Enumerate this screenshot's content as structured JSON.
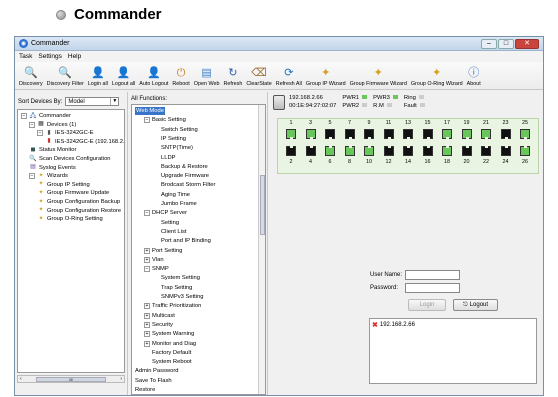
{
  "heading": "Commander",
  "window": {
    "title": "Commander"
  },
  "menu": [
    "Task",
    "Settings",
    "Help"
  ],
  "toolbar": [
    {
      "label": "Discovery",
      "icon": "magnifier-icon"
    },
    {
      "label": "Discovery Filter",
      "icon": "filter-magnifier-icon"
    },
    {
      "label": "Login all",
      "icon": "user-icon"
    },
    {
      "label": "Logout all",
      "icon": "user-gray-icon"
    },
    {
      "label": "Auto Logout",
      "icon": "user-green-icon"
    },
    {
      "label": "Reboot",
      "icon": "reboot-icon"
    },
    {
      "label": "Open Web",
      "icon": "web-page-icon"
    },
    {
      "label": "Refresh",
      "icon": "refresh-icon"
    },
    {
      "label": "ClearState",
      "icon": "clear-state-icon"
    },
    {
      "label": "Refresh All",
      "icon": "refresh-all-icon"
    },
    {
      "label": "Group IP Wizard",
      "icon": "wand-icon"
    },
    {
      "label": "Group Firmware Wizard",
      "icon": "wand-icon"
    },
    {
      "label": "Group O-Ring Wizard",
      "icon": "wand-icon"
    },
    {
      "label": "About",
      "icon": "info-icon"
    }
  ],
  "sort": {
    "label": "Sort Devices By:",
    "value": "Model"
  },
  "tree": [
    {
      "label": "Commander",
      "indent": 0
    },
    {
      "label": "Devices (1)",
      "indent": 1
    },
    {
      "label": "IES-3242GC-E",
      "indent": 2
    },
    {
      "label": "IES-3242GC-E (192.168.2.66,",
      "indent": 3
    },
    {
      "label": "Status Monitor",
      "indent": 1
    },
    {
      "label": "Scan Devices Configuration",
      "indent": 1
    },
    {
      "label": "Syslog Events",
      "indent": 1
    },
    {
      "label": "Wizards",
      "indent": 1
    },
    {
      "label": "Group IP Setting",
      "indent": 2
    },
    {
      "label": "Group Firmware Update",
      "indent": 2
    },
    {
      "label": "Group Configuration Backup",
      "indent": 2
    },
    {
      "label": "Group Configuration Restore",
      "indent": 2
    },
    {
      "label": "Group O-Ring Setting",
      "indent": 2
    }
  ],
  "scroll_arrows": {
    "left": "‹",
    "mid": "III",
    "right": "›"
  },
  "functions": {
    "header": "All Functions:",
    "items": [
      {
        "label": "Web Mode",
        "indent": 0,
        "selected": true
      },
      {
        "label": "Basic Setting",
        "indent": 1,
        "box": "−"
      },
      {
        "label": "Switch Setting",
        "indent": 2
      },
      {
        "label": "IP Setting",
        "indent": 2
      },
      {
        "label": "SNTP(Time)",
        "indent": 2
      },
      {
        "label": "LLDP",
        "indent": 2
      },
      {
        "label": "Backup & Restore",
        "indent": 2
      },
      {
        "label": "Upgrade Firmware",
        "indent": 2
      },
      {
        "label": "Brodcast Storm Filter",
        "indent": 2
      },
      {
        "label": "Aging Time",
        "indent": 2
      },
      {
        "label": "Jumbo Frame",
        "indent": 2
      },
      {
        "label": "DHCP Server",
        "indent": 1,
        "box": "−"
      },
      {
        "label": "Setting",
        "indent": 2
      },
      {
        "label": "Client List",
        "indent": 2
      },
      {
        "label": "Port and IP Binding",
        "indent": 2
      },
      {
        "label": "Port Setting",
        "indent": 1,
        "box": "+"
      },
      {
        "label": "Vlan",
        "indent": 1,
        "box": "+"
      },
      {
        "label": "SNMP",
        "indent": 1,
        "box": "−"
      },
      {
        "label": "System Setting",
        "indent": 2
      },
      {
        "label": "Trap Setting",
        "indent": 2
      },
      {
        "label": "SNMPv3 Setting",
        "indent": 2
      },
      {
        "label": "Traffic Prioritization",
        "indent": 1,
        "box": "+"
      },
      {
        "label": "Multicast",
        "indent": 1,
        "box": "+"
      },
      {
        "label": "Security",
        "indent": 1,
        "box": "+"
      },
      {
        "label": "System Warning",
        "indent": 1,
        "box": "+"
      },
      {
        "label": "Monitor and Diag",
        "indent": 1,
        "box": "+"
      },
      {
        "label": "Factory Default",
        "indent": 1
      },
      {
        "label": "System Reboot",
        "indent": 1
      },
      {
        "label": "Admin Password",
        "indent": 0
      },
      {
        "label": "Save To Flash",
        "indent": 0
      },
      {
        "label": "Restore",
        "indent": 0
      }
    ]
  },
  "device": {
    "ip": "192.168.2.66",
    "mac": "00:1E:94:27:02:07",
    "pwr1": "PWR1",
    "pwr2": "PWR2",
    "pwr3": "PWR3",
    "rm": "R.M",
    "ring": "Ring",
    "fault": "Fault",
    "colors": {
      "on": "#6cc65c",
      "off": "#cccccc"
    }
  },
  "ports": {
    "top_numbers": [
      "1",
      "3",
      "5",
      "7",
      "9",
      "11",
      "13",
      "15",
      "17",
      "19",
      "21",
      "23",
      "25"
    ],
    "bottom_numbers": [
      "2",
      "4",
      "6",
      "8",
      "10",
      "12",
      "14",
      "16",
      "18",
      "20",
      "22",
      "24",
      "26"
    ],
    "top_state": [
      0,
      0,
      1,
      1,
      1,
      1,
      1,
      1,
      0,
      0,
      0,
      1,
      0
    ],
    "bottom_state": [
      1,
      1,
      0,
      0,
      0,
      1,
      1,
      1,
      0,
      1,
      1,
      1,
      0
    ]
  },
  "login": {
    "user_label": "User Name:",
    "password_label": "Password:",
    "login_button": "Login",
    "logout_button": "Logout"
  },
  "result": {
    "ip": "192.168.2.66",
    "mark": "✖"
  }
}
